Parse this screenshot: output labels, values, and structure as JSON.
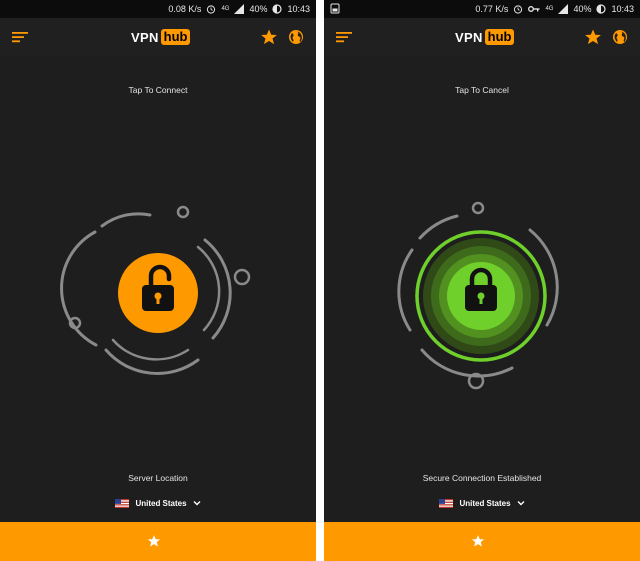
{
  "screens": [
    {
      "state": "disconnected",
      "status_bar": {
        "speed": "0.08 K/s",
        "network": "4G",
        "battery": "40%",
        "time": "10:43"
      },
      "logo": {
        "part1": "VPN",
        "part2": "hub"
      },
      "tap_text": "Tap To Connect",
      "location_label": "Server Location",
      "country": "United States",
      "lock_color": "#ff9900"
    },
    {
      "state": "connected",
      "status_bar": {
        "speed": "0.77 K/s",
        "network": "4G",
        "battery": "40%",
        "time": "10:43"
      },
      "logo": {
        "part1": "VPN",
        "part2": "hub"
      },
      "tap_text": "Tap To Cancel",
      "location_label": "Secure Connection Established",
      "country": "United States",
      "lock_color": "#6fd02b"
    }
  ],
  "colors": {
    "accent": "#ff9900",
    "background": "#1e1e1e",
    "connected_green": "#6fd02b"
  }
}
